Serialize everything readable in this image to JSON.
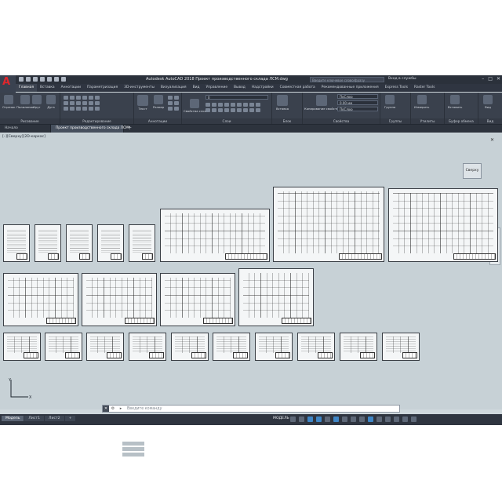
{
  "app": {
    "logo_letter": "A",
    "window_title": "Autodesk AutoCAD 2018   Проект производственного склада ЛСМ.dwg",
    "search_placeholder": "Введите ключевое слово/фразу",
    "sign_in": "Вход в службы",
    "window_controls": [
      "–",
      "□",
      "✕"
    ]
  },
  "menu": [
    "Главная",
    "Вставка",
    "Аннотации",
    "Параметризация",
    "3D-инструменты",
    "Визуализация",
    "Вид",
    "Управление",
    "Вывод",
    "Надстройки",
    "Совместная работа",
    "Рекомендованные приложения",
    "Express Tools",
    "Raster Tools"
  ],
  "menu_active_index": 0,
  "ribbon": {
    "draw_tools": [
      "Отрезок",
      "Полилиния",
      "Круг",
      "Дуга"
    ],
    "panels": [
      "Рисование",
      "Редактирование",
      "Аннотации",
      "Слои",
      "Блок",
      "Свойства",
      "Группы",
      "Утилиты",
      "Буфер обмена",
      "Вид"
    ],
    "annotation_tools": [
      "Текст",
      "Размер"
    ],
    "layer_dropdown": "0",
    "layer_tool": "Свойства слоя",
    "insert_tool": "Вставка",
    "match_tool": "Копирование свойств",
    "props": {
      "color": "ПоСлою",
      "lineweight": "0.00 мм",
      "linetype": "ПоСлою"
    },
    "group_tool": "Группа",
    "measure_tool": "Измерить",
    "paste_tool": "Вставить",
    "view_tool": "Вид"
  },
  "tabs": [
    {
      "label": "Начало",
      "active": false
    },
    {
      "label": "Проект производственного склада ЛСМ*",
      "active": true
    }
  ],
  "viewport": {
    "label": "[–][Сверху][2D-каркас]",
    "viewcube_label": "Сверху",
    "close_glyph": "✕"
  },
  "command": {
    "placeholder": "Введите команду",
    "close_glyph": "✕"
  },
  "status": {
    "layout_tabs": [
      "Модель",
      "Лист1",
      "Лист2"
    ],
    "add_tab": "+",
    "model_label": "МОДЕЛЬ"
  },
  "colors": {
    "canvas": "#c7d1d6",
    "ribbon": "#3a414d",
    "title": "#2b313b",
    "accent": "#3f86c6",
    "logo": "#e0262c"
  }
}
